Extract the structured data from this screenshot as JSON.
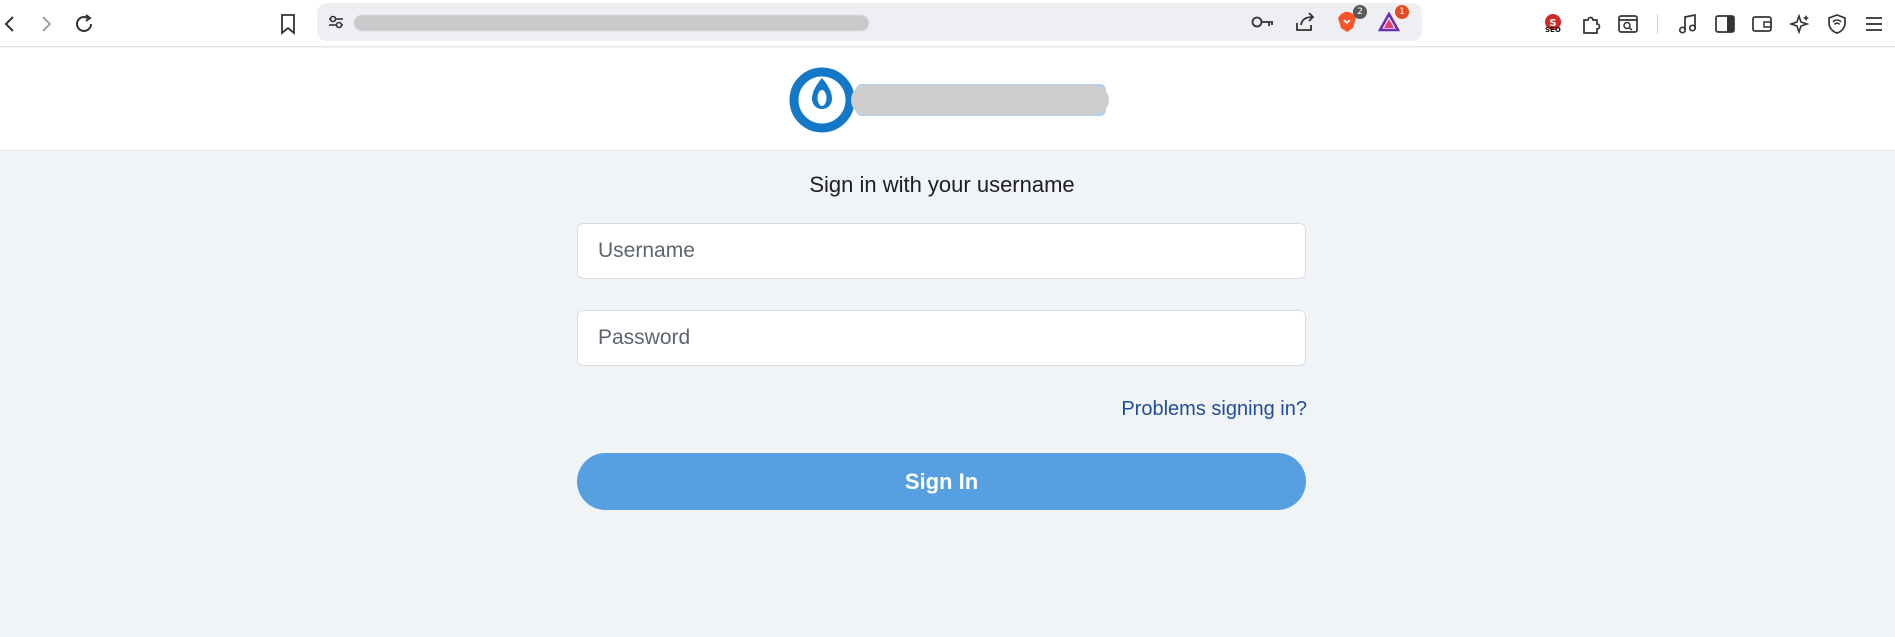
{
  "browser": {
    "url_display": "",
    "shields_badge": "2",
    "rewards_badge": "1",
    "seo_extension_label": "SEO",
    "icons": [
      "back-icon",
      "forward-icon",
      "reload-icon",
      "bookmark-icon",
      "site-settings-icon",
      "key-icon",
      "share-icon",
      "brave-shields-icon",
      "brave-rewards-icon",
      "seo-extension-icon",
      "extensions-icon",
      "tab-search-icon",
      "media-icon",
      "sidebar-icon",
      "wallet-icon",
      "leo-ai-icon",
      "vpn-icon",
      "menu-icon"
    ]
  },
  "page": {
    "heading": "Sign in with your username",
    "username_placeholder": "Username",
    "password_placeholder": "Password",
    "problems_link": "Problems signing in?",
    "signin_label": "Sign In",
    "colors": {
      "background": "#f1f4f7",
      "button": "#569fe0",
      "link": "#1f4d9b",
      "logo_blue": "#1478c8"
    }
  }
}
